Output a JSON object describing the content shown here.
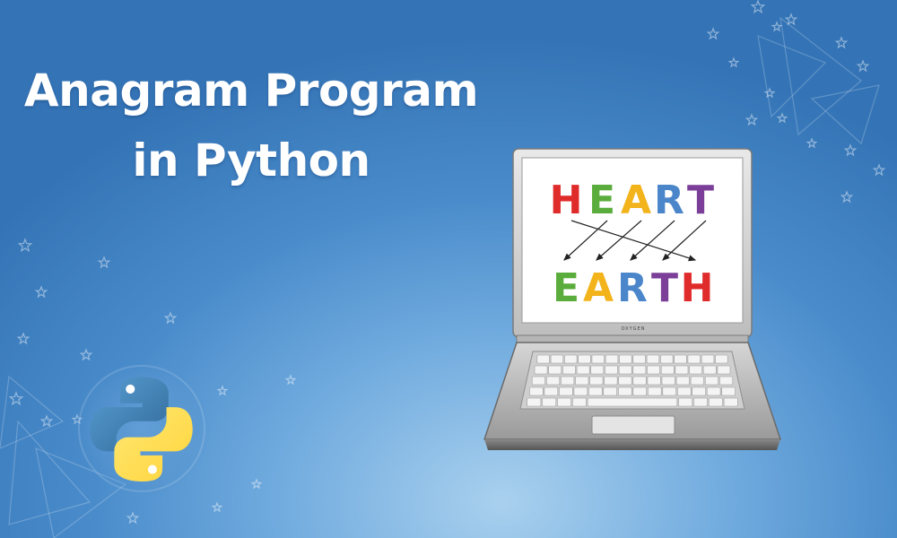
{
  "title": {
    "line1": "Anagram Program",
    "line2": "in Python"
  },
  "laptop": {
    "brand": "OXYGEN"
  },
  "anagram": {
    "top_word": [
      {
        "ch": "H",
        "color": "#e02b2b"
      },
      {
        "ch": "E",
        "color": "#5aad3c"
      },
      {
        "ch": "A",
        "color": "#f2b31b"
      },
      {
        "ch": "R",
        "color": "#4a86c9"
      },
      {
        "ch": "T",
        "color": "#7b3f99"
      }
    ],
    "bottom_word": [
      {
        "ch": "E",
        "color": "#5aad3c"
      },
      {
        "ch": "A",
        "color": "#f2b31b"
      },
      {
        "ch": "R",
        "color": "#4a86c9"
      },
      {
        "ch": "T",
        "color": "#7b3f99"
      },
      {
        "ch": "H",
        "color": "#e02b2b"
      }
    ]
  },
  "icons": {
    "logo": "python-logo-icon",
    "decor": "star-icon"
  },
  "colors": {
    "python_blue": "#3c78aa",
    "python_yellow": "#ffd43b",
    "background": "#4a8ccb"
  }
}
